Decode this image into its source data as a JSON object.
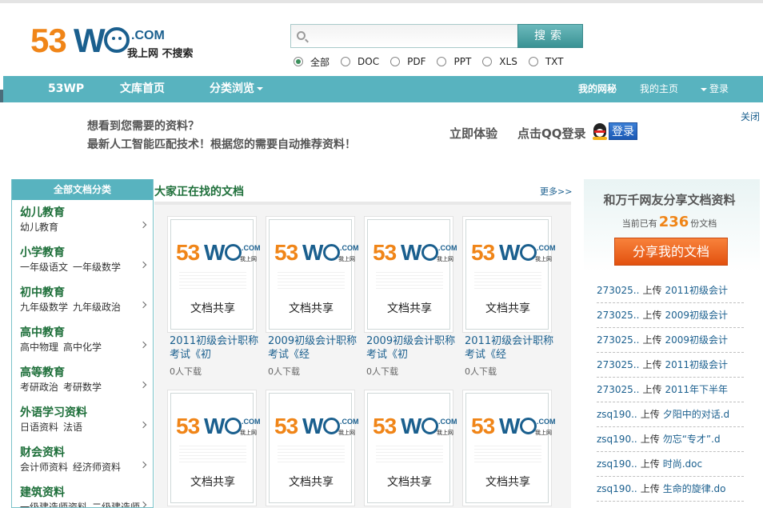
{
  "header": {
    "logo_num": "53",
    "logo_w": "W",
    "logo_com": ".COM",
    "logo_slogan": "我上网 不搜索",
    "search_placeholder": "",
    "search_button": "搜索",
    "filetypes": [
      {
        "label": "全部",
        "selected": true
      },
      {
        "label": "DOC",
        "selected": false
      },
      {
        "label": "PDF",
        "selected": false
      },
      {
        "label": "PPT",
        "selected": false
      },
      {
        "label": "XLS",
        "selected": false
      },
      {
        "label": "TXT",
        "selected": false
      }
    ]
  },
  "nav": {
    "home": "53WP",
    "library": "文库首页",
    "browse": "分类浏览",
    "my_secret": "我的网秘",
    "my_page": "我的主页",
    "login": "登录"
  },
  "recommend": {
    "line1": "想看到您需要的资料？",
    "line2": "最新人工智能匹配技术！根据您的需要自动推荐资料！",
    "try_now": "立即体验",
    "qq_text": "点击QQ登录",
    "qq_button": "登录",
    "close": "关闭"
  },
  "categories": {
    "header": "全部文档分类",
    "groups": [
      {
        "title": "幼儿教育",
        "subs": [
          "幼儿教育"
        ]
      },
      {
        "title": "小学教育",
        "subs": [
          "一年级语文",
          "一年级数学"
        ]
      },
      {
        "title": "初中教育",
        "subs": [
          "九年级数学",
          "九年级政治"
        ]
      },
      {
        "title": "高中教育",
        "subs": [
          "高中物理",
          "高中化学"
        ]
      },
      {
        "title": "高等教育",
        "subs": [
          "考研政治",
          "考研数学"
        ]
      },
      {
        "title": "外语学习资料",
        "subs": [
          "日语资料",
          "法语"
        ]
      },
      {
        "title": "财会资料",
        "subs": [
          "会计师资料",
          "经济师资料"
        ]
      },
      {
        "title": "建筑资料",
        "subs": [
          "一级建造师资料",
          "二级建造师"
        ]
      }
    ]
  },
  "docs": {
    "title": "大家正在找的文档",
    "more": "更多>>",
    "thumb_label": "文档共享",
    "thumb_slogan": "我上网",
    "items": [
      {
        "title": "2011初级会计职称考试《初",
        "downloads": "0人下载"
      },
      {
        "title": "2009初级会计职称考试《经",
        "downloads": "0人下载"
      },
      {
        "title": "2009初级会计职称考试《初",
        "downloads": "0人下载"
      },
      {
        "title": "2011初级会计职称考试《经",
        "downloads": "0人下载"
      },
      {
        "title": "",
        "downloads": ""
      },
      {
        "title": "",
        "downloads": ""
      },
      {
        "title": "",
        "downloads": ""
      },
      {
        "title": "",
        "downloads": ""
      }
    ]
  },
  "share": {
    "title": "和万千网友分享文档资料",
    "count_prefix": "当前已有",
    "count": "236",
    "count_suffix": "份文档",
    "button": "分享我的文档",
    "uploads": [
      {
        "user": "273025..",
        "verb": "上传",
        "doc": "2011初级会计"
      },
      {
        "user": "273025..",
        "verb": "上传",
        "doc": "2009初级会计"
      },
      {
        "user": "273025..",
        "verb": "上传",
        "doc": "2009初级会计"
      },
      {
        "user": "273025..",
        "verb": "上传",
        "doc": "2011初级会计"
      },
      {
        "user": "273025..",
        "verb": "上传",
        "doc": "2011年下半年"
      },
      {
        "user": "zsq190..",
        "verb": "上传",
        "doc": "夕阳中的对话.d"
      },
      {
        "user": "zsq190..",
        "verb": "上传",
        "doc": "勿忘“专才”.d"
      },
      {
        "user": "zsq190..",
        "verb": "上传",
        "doc": "时尚.doc"
      },
      {
        "user": "zsq190..",
        "verb": "上传",
        "doc": "生命的旋律.do"
      }
    ]
  },
  "colors": {
    "nav_teal": "#58b3bf",
    "logo_orange": "#f08518",
    "logo_blue": "#1a5f8e",
    "category_green": "#1e6f3a",
    "share_orange": "#e2510f"
  }
}
